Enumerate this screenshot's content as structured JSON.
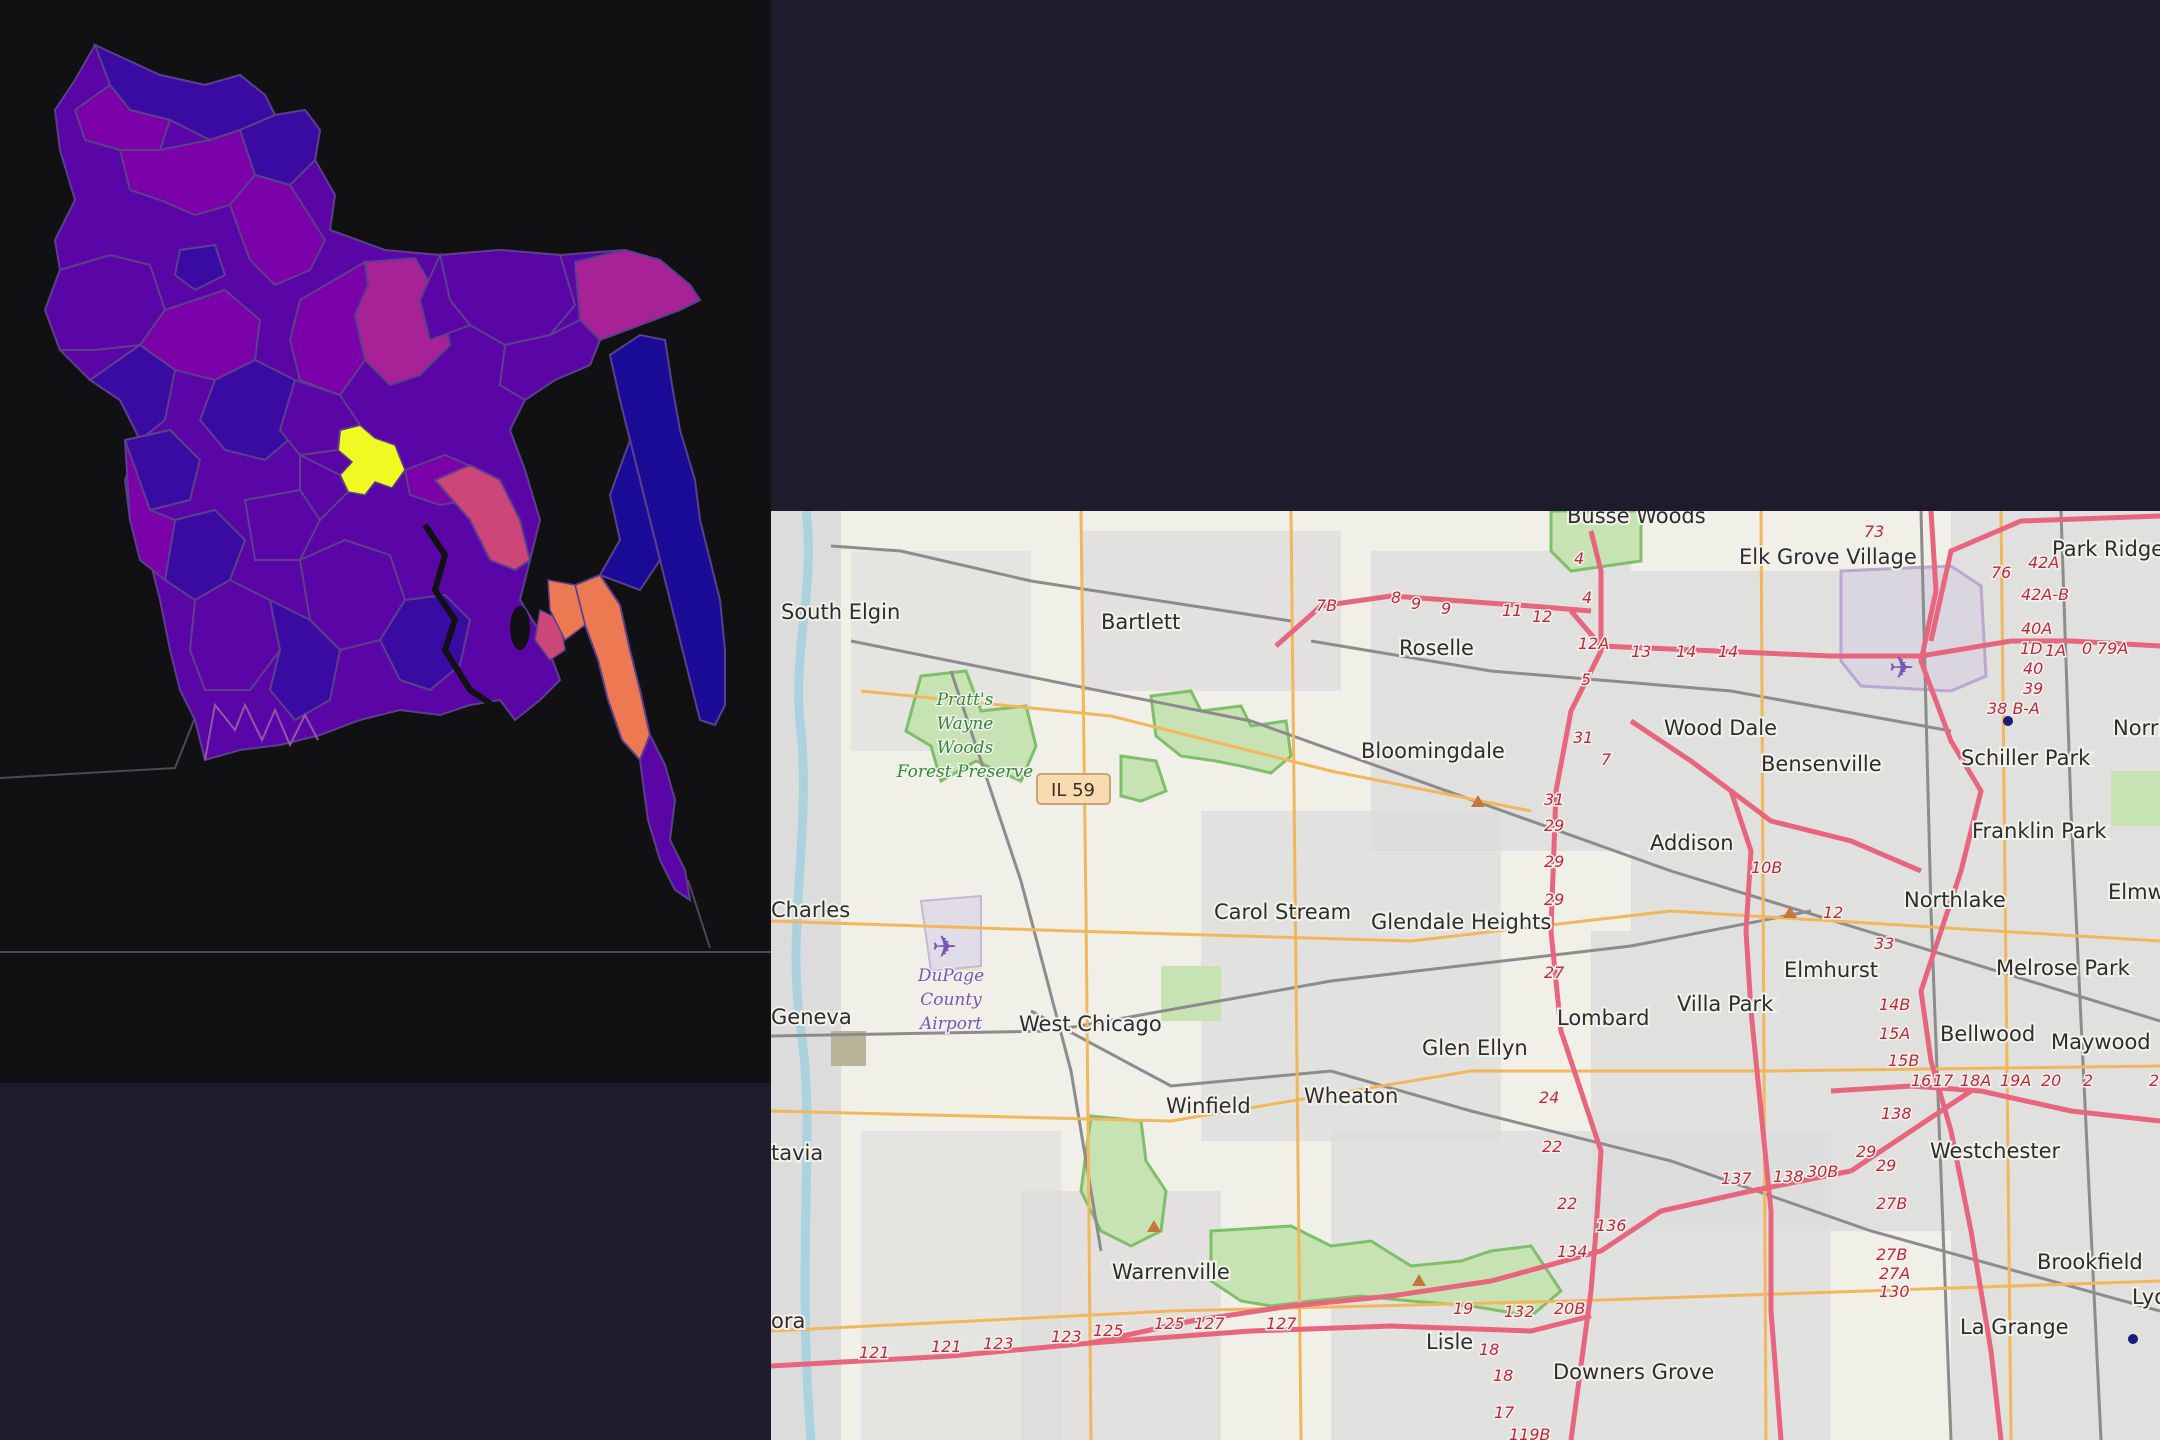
{
  "choropleth": {
    "colors": {
      "background": "#111114",
      "border": "#5b3f8c",
      "scale": [
        "#1a0b96",
        "#3a0ba3",
        "#5a06a6",
        "#7a02a8",
        "#a72197",
        "#cc4778",
        "#ed7953",
        "#f0f921"
      ]
    },
    "highlights": {
      "max_color": "#f0f921",
      "coastal_high_color": "#ed7953",
      "east_low_color": "#1a0b96"
    }
  },
  "streetmap": {
    "colors": {
      "land": "#f0efe8",
      "urban": "#dcdcdc",
      "park": "#c8e3b3",
      "forest_border": "#7fbf6a",
      "motorway": "#e8657e",
      "primary": "#f2b75a",
      "rail": "#8c8c8c",
      "river": "#aad3df"
    },
    "places": [
      {
        "name": "Elk Grove Village"
      },
      {
        "name": "Park Ridge"
      },
      {
        "name": "South Elgin"
      },
      {
        "name": "Bartlett"
      },
      {
        "name": "Roselle"
      },
      {
        "name": "Wood Dale"
      },
      {
        "name": "Norric"
      },
      {
        "name": "Bloomingdale"
      },
      {
        "name": "Bensenville"
      },
      {
        "name": "Schiller Park"
      },
      {
        "name": "Franklin Park"
      },
      {
        "name": "Addison"
      },
      {
        "name": "Charles"
      },
      {
        "name": "Carol Stream"
      },
      {
        "name": "Glendale Heights"
      },
      {
        "name": "Northlake"
      },
      {
        "name": "Elmw"
      },
      {
        "name": "Elmhurst"
      },
      {
        "name": "Melrose Park"
      },
      {
        "name": "Geneva"
      },
      {
        "name": "West Chicago"
      },
      {
        "name": "Lombard"
      },
      {
        "name": "Villa Park"
      },
      {
        "name": "Bellwood"
      },
      {
        "name": "Maywood"
      },
      {
        "name": "Glen Ellyn"
      },
      {
        "name": "Winfield"
      },
      {
        "name": "Wheaton"
      },
      {
        "name": "tavia"
      },
      {
        "name": "Westchester"
      },
      {
        "name": "Brookfield"
      },
      {
        "name": "Warrenville"
      },
      {
        "name": "Lyo"
      },
      {
        "name": "ora"
      },
      {
        "name": "La Grange"
      },
      {
        "name": "Lisle"
      },
      {
        "name": "Downers Grove"
      }
    ],
    "parks": [
      {
        "name": "Pratt's Wayne Woods Forest Preserve",
        "lines": [
          "Pratt's",
          "Wayne",
          "Woods",
          "Forest Preserve"
        ]
      }
    ],
    "airports": [
      {
        "name": "DuPage County Airport",
        "lines": [
          "DuPage",
          "County",
          "Airport"
        ]
      }
    ],
    "shields": [
      {
        "label": "IL 59"
      }
    ],
    "exits": [
      "73",
      "76",
      "42A",
      "42A-B",
      "40A",
      "1D",
      "1A",
      "0",
      "79A",
      "40",
      "39",
      "38 B-A",
      "7B",
      "8",
      "9",
      "9",
      "11",
      "12",
      "4",
      "4",
      "12A",
      "13",
      "14",
      "14",
      "5",
      "31",
      "7",
      "31",
      "29",
      "29",
      "29",
      "27",
      "10B",
      "12",
      "33",
      "14B",
      "15A",
      "15B",
      "16",
      "17",
      "18A",
      "19A",
      "20",
      "2",
      "24",
      "24",
      "22",
      "22",
      "134",
      "136",
      "137",
      "138",
      "30B",
      "138",
      "29",
      "29",
      "27B",
      "27B",
      "27A",
      "130",
      "19",
      "132",
      "20B",
      "18",
      "18",
      "17",
      "119B",
      "121",
      "121",
      "123",
      "123",
      "125",
      "125",
      "127",
      "127"
    ]
  }
}
